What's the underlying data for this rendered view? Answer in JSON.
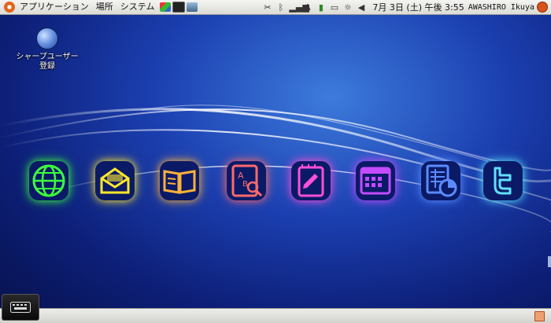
{
  "top_panel": {
    "menus": [
      "アプリケーション",
      "場所",
      "システム"
    ],
    "clock": "7月 3日 (土) 午後 3:55",
    "user": "AWASHIRO Ikuya",
    "tray_icons": [
      "tools-icon",
      "bluetooth-icon",
      "signal-icon",
      "font-icon",
      "network-icon",
      "battery-icon",
      "brightness-icon",
      "volume-icon"
    ]
  },
  "desktop": {
    "icon_label_line1": "シャープユーザー",
    "icon_label_line2": "登録"
  },
  "dock": {
    "apps": [
      {
        "icon": "browser-globe-icon",
        "color": "#3cff3c"
      },
      {
        "icon": "mail-icon",
        "color": "#ffe82a"
      },
      {
        "icon": "ebook-icon",
        "color": "#ffb23a"
      },
      {
        "icon": "dictionary-icon",
        "color": "#ff6a6a"
      },
      {
        "icon": "note-icon",
        "color": "#ff4fd8"
      },
      {
        "icon": "calendar-icon",
        "color": "#c54bff"
      },
      {
        "icon": "spreadsheet-icon",
        "color": "#5a8cff"
      },
      {
        "icon": "twitter-icon",
        "color": "#5fe0ff"
      }
    ]
  }
}
